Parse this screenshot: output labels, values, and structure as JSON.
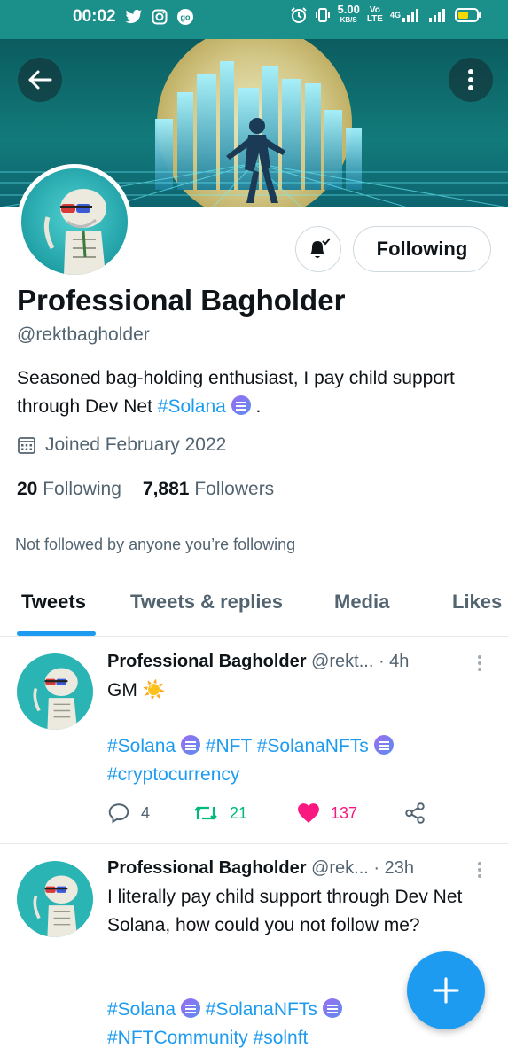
{
  "status_bar": {
    "time": "00:02",
    "net_speed": "5.00",
    "net_speed_unit": "KB/S",
    "volte_top": "Vo",
    "volte_bottom": "LTE",
    "network": "4G"
  },
  "colors": {
    "accent": "#1d9bf0",
    "retweet": "#00ba7c",
    "like": "#f91880",
    "status_bar": "#1b8f8a"
  },
  "profile": {
    "name": "Professional Bagholder",
    "handle": "@rektbagholder",
    "bio_text": "Seasoned bag-holding enthusiast, I pay child support through Dev Net ",
    "bio_hashtag": "#Solana",
    "bio_end": " .",
    "joined": "Joined February 2022",
    "following_count": "20",
    "following_label": "Following",
    "followers_count": "7,881",
    "followers_label": "Followers",
    "not_followed_text": "Not followed by anyone you’re following",
    "following_button": "Following"
  },
  "tabs": [
    {
      "label": "Tweets",
      "active": true
    },
    {
      "label": "Tweets & replies",
      "active": false
    },
    {
      "label": "Media",
      "active": false
    },
    {
      "label": "Likes",
      "active": false
    }
  ],
  "tweets": [
    {
      "name": "Professional Bagholder",
      "handle": "@rekt...",
      "time": "· 4h",
      "text": "GM ☀️",
      "tags_line1": [
        "#Solana",
        "#NFT",
        "#SolanaNFTs"
      ],
      "tags_line2": "#cryptocurrency",
      "replies": "4",
      "retweets": "21",
      "likes": "137"
    },
    {
      "name": "Professional Bagholder",
      "handle": "@rek...",
      "time": "· 23h",
      "text": "I literally pay child support through Dev Net Solana, how could you not follow me?",
      "tags_line1": [
        "#Solana",
        "#SolanaNFTs"
      ],
      "tags_line2": "#NFTCommunity #solnft"
    }
  ],
  "icons": {
    "back": "arrow-left-icon",
    "more": "more-vertical-icon",
    "bell": "bell-check-icon",
    "calendar": "calendar-icon",
    "reply": "reply-icon",
    "retweet": "retweet-icon",
    "like": "heart-icon",
    "share": "share-icon",
    "compose": "plus-icon"
  }
}
